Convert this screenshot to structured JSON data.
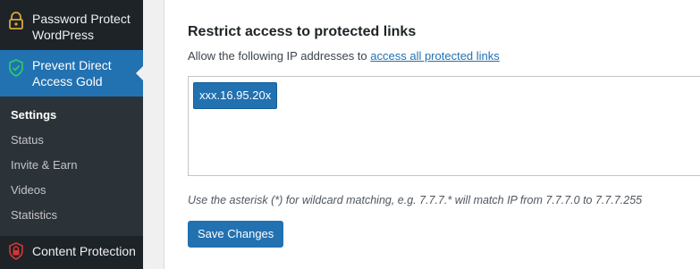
{
  "sidebar": {
    "items": [
      {
        "label": "Password Protect WordPress",
        "icon": "lock-icon"
      },
      {
        "label": "Prevent Direct Access Gold",
        "icon": "shield-check-icon"
      },
      {
        "label": "Content Protection",
        "icon": "lock-icon"
      }
    ],
    "submenu": [
      "Settings",
      "Status",
      "Invite & Earn",
      "Videos",
      "Statistics"
    ],
    "current_submenu": "Settings"
  },
  "section": {
    "title": "Restrict access to protected links",
    "desc_prefix": "Allow the following IP addresses to ",
    "desc_link": "access all protected links",
    "ip_tags": [
      "xxx.16.95.20x"
    ],
    "hint": "Use the asterisk (*) for wildcard matching, e.g. 7.7.7.* will match IP from 7.7.7.0 to 7.7.7.255",
    "save_label": "Save Changes"
  },
  "colors": {
    "sidebar_bg": "#1d2327",
    "submenu_bg": "#2c3338",
    "accent": "#2271b1",
    "ppwp_icon": "#d8a83a",
    "pda_icon": "#28c76f",
    "cp_icon": "#d63638"
  }
}
